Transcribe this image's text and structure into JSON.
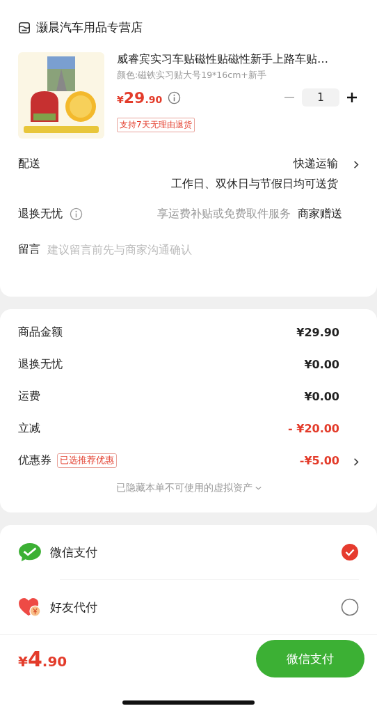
{
  "store": {
    "name": "灏晨汽车用品专营店"
  },
  "product": {
    "title": "威睿宾实习车贴磁性贴磁性新手上路车贴…",
    "spec": "颜色:磁铁实习贴大号19*16cm+新手",
    "price": {
      "currency": "¥",
      "integer": "29",
      "decimal": ".90"
    },
    "quantity": "1",
    "badge": "支持7天无理由退货"
  },
  "delivery": {
    "label": "配送",
    "method": "快递运输",
    "note": "工作日、双休日与节假日均可送货"
  },
  "returns": {
    "label": "退换无忧",
    "desc": "享运费补贴或免费取件服务",
    "value": "商家赠送"
  },
  "message": {
    "label": "留言",
    "placeholder": "建议留言前先与商家沟通确认"
  },
  "summary": [
    {
      "label": "商品金额",
      "value": "¥29.90",
      "discount": false
    },
    {
      "label": "退换无忧",
      "value": "¥0.00",
      "discount": false
    },
    {
      "label": "运费",
      "value": "¥0.00",
      "discount": false
    },
    {
      "label": "立减",
      "value": "- ¥20.00",
      "discount": true
    },
    {
      "label": "优惠券",
      "tag": "已选推荐优惠",
      "value": "-¥5.00",
      "discount": true,
      "link": true
    }
  ],
  "hidden_note": "已隐藏本单不可使用的虚拟资产",
  "payment_methods": [
    {
      "kind": "wechat",
      "label": "微信支付",
      "selected": true
    },
    {
      "kind": "friend",
      "label": "好友代付",
      "selected": false
    }
  ],
  "footer": {
    "total": {
      "currency": "¥",
      "integer": "4",
      "decimal": ".90"
    },
    "pay_button": "微信支付"
  }
}
